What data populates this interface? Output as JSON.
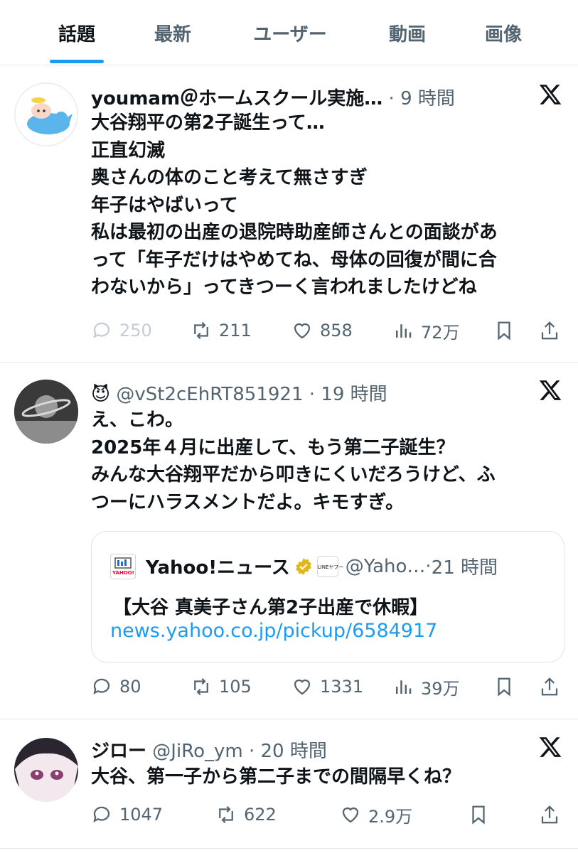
{
  "tabs": [
    {
      "label": "話題",
      "active": true
    },
    {
      "label": "最新",
      "active": false
    },
    {
      "label": "ユーザー",
      "active": false
    },
    {
      "label": "動画",
      "active": false
    },
    {
      "label": "画像",
      "active": false
    }
  ],
  "posts": [
    {
      "name": "youmam＠ホームスクール実施…",
      "handle": "",
      "time": "9 時間",
      "body": "大谷翔平の第2子誕生って…\n正直幻滅\n奥さんの体のこと考えて無さすぎ\n年子はやばいって\n私は最初の出産の退院時助産師さんとの面談があ\nって「年子だけはやめてね、母体の回復が間に合\nわないから」ってきつーく言われましたけどね",
      "replies": "250",
      "reposts": "211",
      "likes": "858",
      "views": "72万"
    },
    {
      "name": "😈",
      "handle": "@vSt2cEhRT851921",
      "time": "19 時間",
      "body": "え、こわ。\n2025年４月に出産して、もう第二子誕生？\nみんな大谷翔平だから叩きにくいだろうけど、ふ\nつーにハラスメントだよ。キモすぎ。",
      "quote": {
        "logo_text": "YAHOO!",
        "name": "Yahoo!ニュース",
        "line_badge": "LINEヤフー",
        "handle": "@Yaho…",
        "time": "21 時間",
        "title": "【大谷 真美子さん第2子出産で休暇】",
        "link": "news.yahoo.co.jp/pickup/6584917"
      },
      "replies": "80",
      "reposts": "105",
      "likes": "1331",
      "views": "39万"
    },
    {
      "name": "ジロー",
      "handle": "@JiRo_ym",
      "time": "20 時間",
      "body": "大谷、第一子から第二子までの間隔早くね？",
      "replies": "1047",
      "reposts": "622",
      "likes": "2.9万"
    }
  ],
  "colors": {
    "accent": "#1d9bf0",
    "secondary_text": "#536471",
    "border": "#e6e9ec"
  }
}
